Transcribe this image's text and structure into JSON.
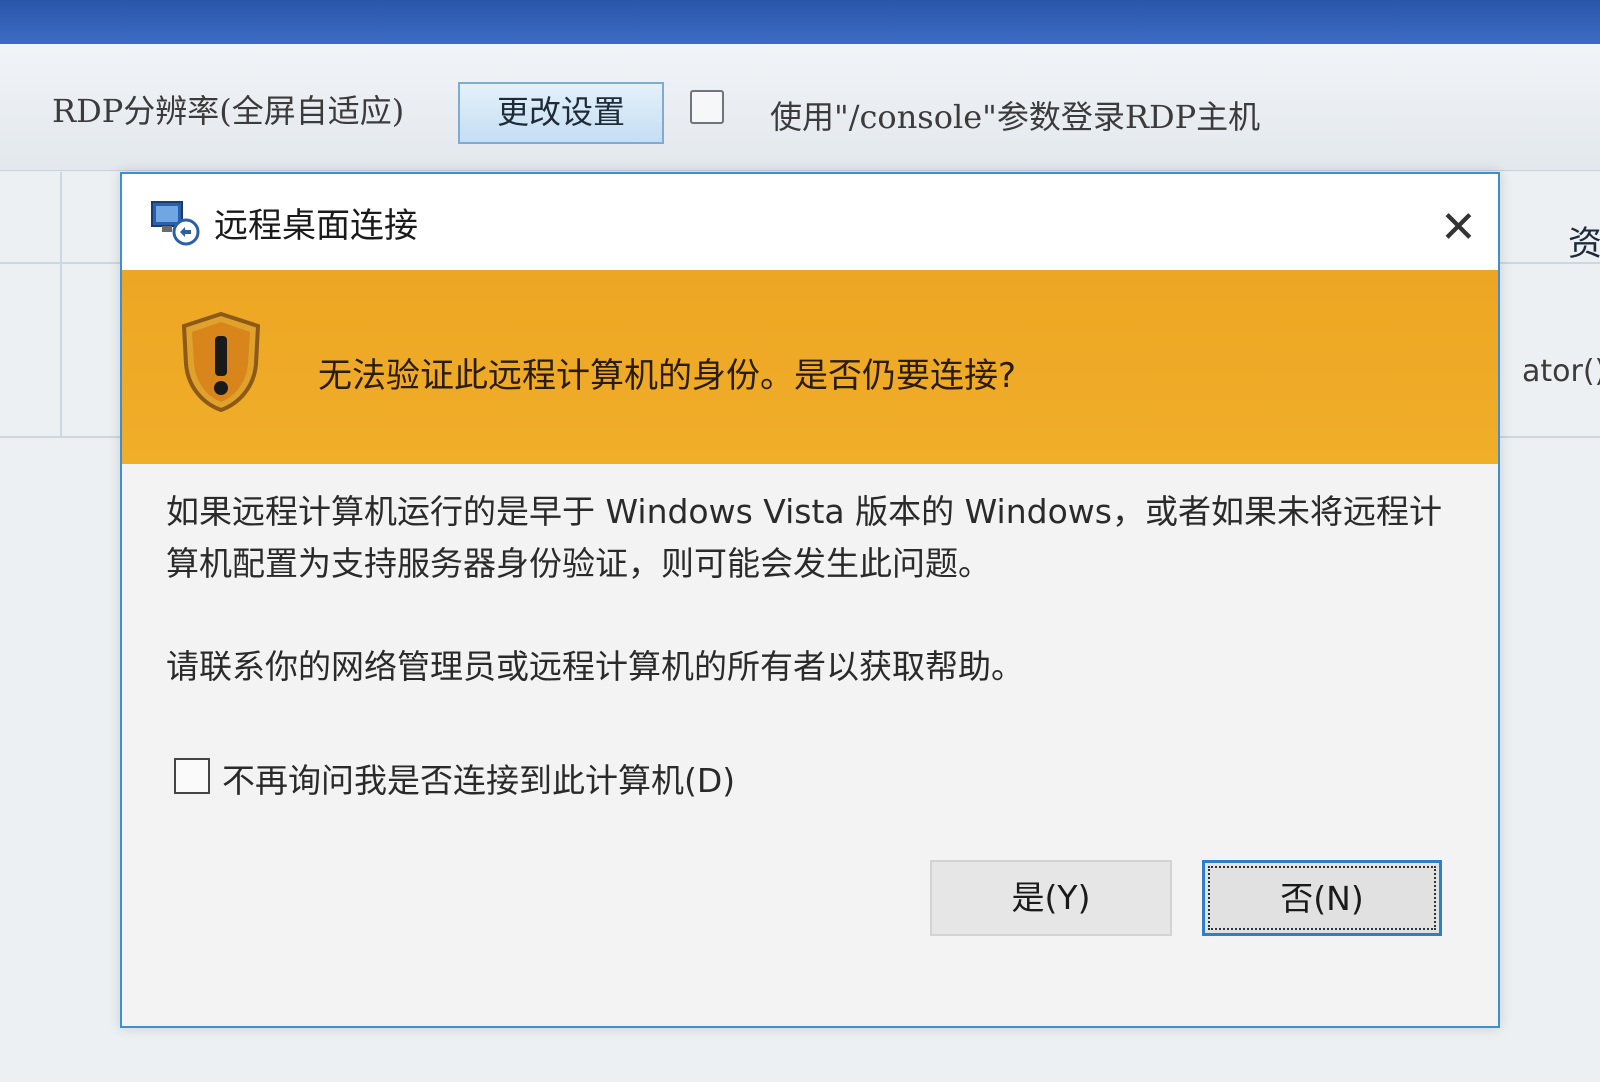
{
  "background": {
    "rdp_resolution_label": "RDP分辨率(全屏自适应)",
    "change_settings_button": "更改设置",
    "console_option_label": "使用\"/console\"参数登录RDP主机",
    "right_edge_char": "资",
    "right_edge_text": "ator()"
  },
  "dialog": {
    "title": "远程桌面连接",
    "icons": {
      "title": "remote-desktop-icon",
      "close": "close-icon",
      "warning": "warning-shield-icon"
    },
    "warning_message": "无法验证此远程计算机的身份。是否仍要连接?",
    "description": "如果远程计算机运行的是早于 Windows Vista 版本的 Windows，或者如果未将远程计算机配置为支持服务器身份验证，则可能会发生此问题。",
    "help_text": "请联系你的网络管理员或远程计算机的所有者以获取帮助。",
    "dont_ask_label": "不再询问我是否连接到此计算机(D)",
    "dont_ask_checked": false,
    "yes_button": "是(Y)",
    "no_button": "否(N)",
    "default_button": "否(N)"
  },
  "colors": {
    "banner": "#eda623",
    "dialog_border": "#3f8fd0",
    "focus_border": "#2e7fc6",
    "taskbar": "#2a56a8"
  }
}
